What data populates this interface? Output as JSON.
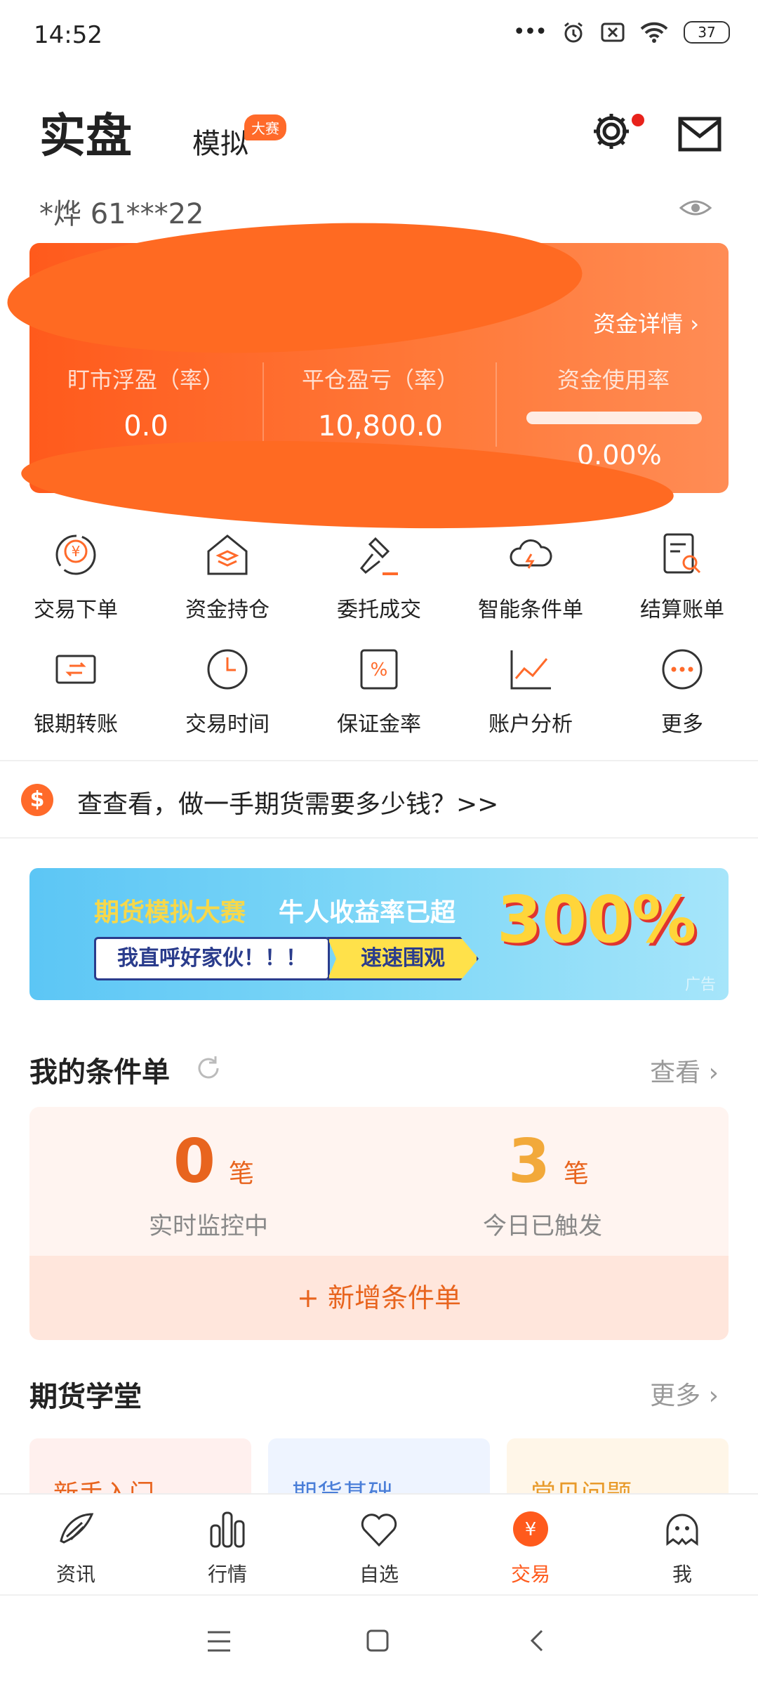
{
  "status_bar": {
    "time": "14:52",
    "dots": "•••",
    "battery": "37"
  },
  "header": {
    "tab_real": "实盘",
    "tab_sim": "模拟",
    "contest_badge": "大赛"
  },
  "account": {
    "masked": "*烨  61***22"
  },
  "card": {
    "fund_detail": "资金详情 ›",
    "metrics": [
      {
        "label": "盯市浮盈（率）",
        "value": "0.0"
      },
      {
        "label": "平仓盈亏（率）",
        "value": "10,800.0"
      },
      {
        "label": "资金使用率",
        "value": "0.00%"
      }
    ]
  },
  "grid": [
    {
      "label": "交易下单",
      "icon": "yen-circle-icon"
    },
    {
      "label": "资金持仓",
      "icon": "house-stack-icon"
    },
    {
      "label": "委托成交",
      "icon": "gavel-icon"
    },
    {
      "label": "智能条件单",
      "icon": "cloud-lightning-icon"
    },
    {
      "label": "结算账单",
      "icon": "document-search-icon"
    },
    {
      "label": "银期转账",
      "icon": "card-transfer-icon"
    },
    {
      "label": "交易时间",
      "icon": "clock-icon"
    },
    {
      "label": "保证金率",
      "icon": "percent-icon"
    },
    {
      "label": "账户分析",
      "icon": "line-chart-icon"
    },
    {
      "label": "更多",
      "icon": "more-dots-icon"
    }
  ],
  "notice": {
    "icon_text": "$",
    "text": "查查看，做一手期货需要多少钱？>>"
  },
  "banner": {
    "title_a": "期货模拟大赛",
    "title_b": "牛人收益率已超",
    "percent": "300%",
    "call": "我直呼好家伙！！！",
    "go": "速速围观",
    "ad": "广告"
  },
  "conditions": {
    "title": "我的条件单",
    "view": "查看 ›",
    "monitoring_count": "0",
    "monitoring_unit": "笔",
    "monitoring_label": "实时监控中",
    "triggered_count": "3",
    "triggered_unit": "笔",
    "triggered_label": "今日已触发",
    "add_label": "+  新增条件单"
  },
  "school": {
    "title": "期货学堂",
    "more": "更多 ›",
    "cards": [
      "新手入门",
      "期货基础",
      "常见问题"
    ]
  },
  "bottom_nav": [
    {
      "label": "资讯",
      "icon": "news-feather-icon"
    },
    {
      "label": "行情",
      "icon": "bar-chart-icon"
    },
    {
      "label": "自选",
      "icon": "heart-icon"
    },
    {
      "label": "交易",
      "icon": "yen-badge-icon"
    },
    {
      "label": "我",
      "icon": "ghost-avatar-icon"
    }
  ],
  "colors": {
    "accent": "#ff6a2a",
    "active_nav": "#ff5a1c",
    "text": "#222222"
  }
}
